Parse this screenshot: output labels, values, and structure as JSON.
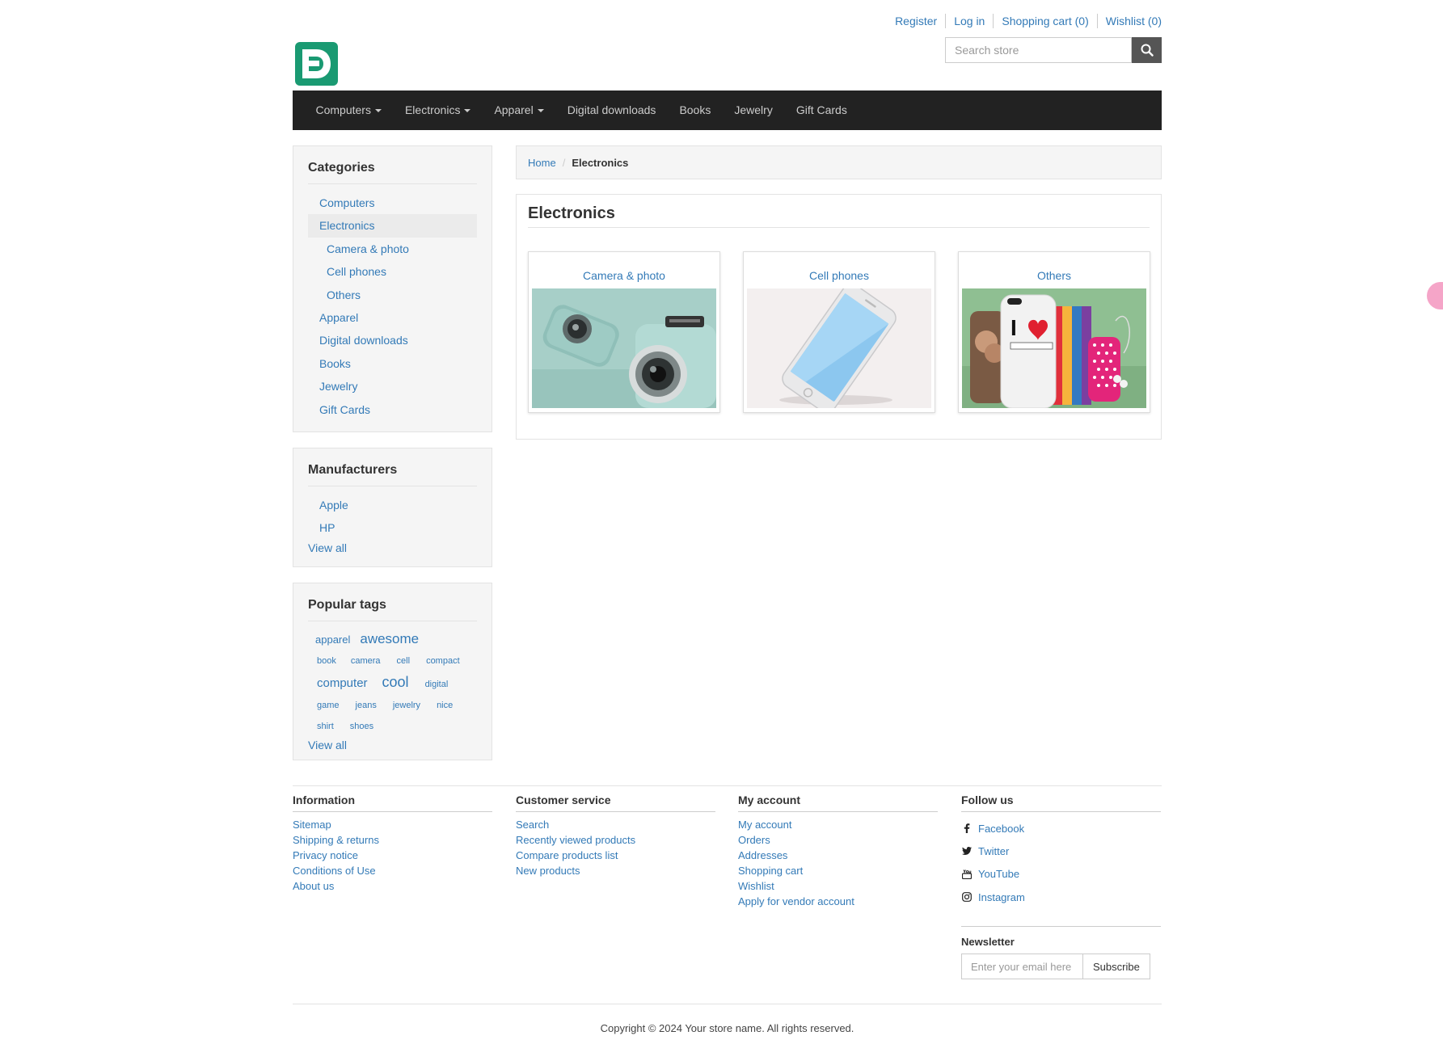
{
  "header": {
    "links": [
      "Register",
      "Log in",
      "Shopping cart (0)",
      "Wishlist (0)"
    ],
    "search_placeholder": "Search store"
  },
  "nav": {
    "items": [
      {
        "label": "Computers",
        "dropdown": true
      },
      {
        "label": "Electronics",
        "dropdown": true
      },
      {
        "label": "Apparel",
        "dropdown": true
      },
      {
        "label": "Digital downloads",
        "dropdown": false
      },
      {
        "label": "Books",
        "dropdown": false
      },
      {
        "label": "Jewelry",
        "dropdown": false
      },
      {
        "label": "Gift Cards",
        "dropdown": false
      }
    ]
  },
  "sidebar": {
    "categories": {
      "title": "Categories",
      "items": [
        "Computers",
        "Electronics",
        "Camera & photo",
        "Cell phones",
        "Others",
        "Apparel",
        "Digital downloads",
        "Books",
        "Jewelry",
        "Gift Cards"
      ],
      "active": "Electronics"
    },
    "manufacturers": {
      "title": "Manufacturers",
      "items": [
        "Apple",
        "HP"
      ],
      "view_all": "View all"
    },
    "tags": {
      "title": "Popular tags",
      "items": [
        "apparel",
        "awesome",
        "book",
        "camera",
        "cell",
        "compact",
        "computer",
        "cool",
        "digital",
        "game",
        "jeans",
        "jewelry",
        "nice",
        "shirt",
        "shoes"
      ],
      "view_all": "View all"
    }
  },
  "breadcrumb": {
    "home": "Home",
    "current": "Electronics"
  },
  "main": {
    "title": "Electronics",
    "subcategories": [
      "Camera & photo",
      "Cell phones",
      "Others"
    ]
  },
  "footer": {
    "information": {
      "title": "Information",
      "links": [
        "Sitemap",
        "Shipping & returns",
        "Privacy notice",
        "Conditions of Use",
        "About us"
      ]
    },
    "customer_service": {
      "title": "Customer service",
      "links": [
        "Search",
        "Recently viewed products",
        "Compare products list",
        "New products"
      ]
    },
    "my_account": {
      "title": "My account",
      "links": [
        "My account",
        "Orders",
        "Addresses",
        "Shopping cart",
        "Wishlist",
        "Apply for vendor account"
      ]
    },
    "follow_us": {
      "title": "Follow us",
      "links": [
        "Facebook",
        "Twitter",
        "YouTube",
        "Instagram"
      ]
    },
    "newsletter": {
      "title": "Newsletter",
      "placeholder": "Enter your email here",
      "button": "Subscribe"
    },
    "copyright": "Copyright © 2024 Your store name. All rights reserved."
  },
  "colors": {
    "link": "#337ab7",
    "nav_bg": "#222222",
    "logo": "#1a9a72"
  }
}
